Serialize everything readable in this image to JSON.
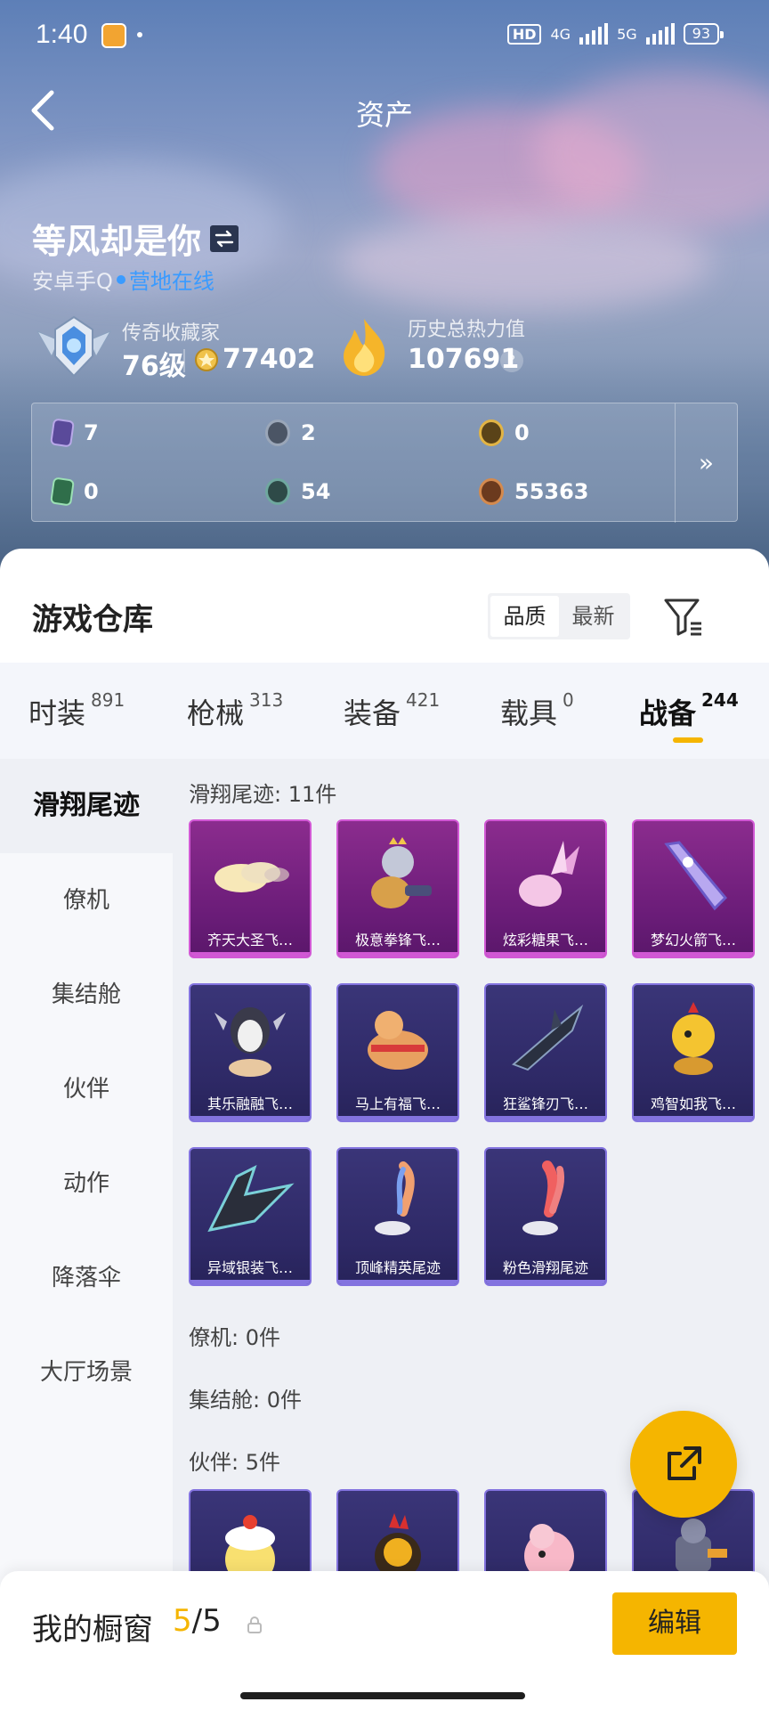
{
  "status_bar": {
    "time": "1:40",
    "network1": "4G",
    "network2": "5G",
    "battery": "93",
    "hd": "HD"
  },
  "header": {
    "title": "资产"
  },
  "profile": {
    "name": "等风却是你",
    "sub_prefix": "安卓手Q",
    "online_text": "营地在线",
    "collector_title": "传奇收藏家",
    "level": "76级",
    "coins": "77402",
    "heat_title": "历史总热力值",
    "heat_value": "107691",
    "help": "?"
  },
  "resources": [
    {
      "icon": "purple-card-icon",
      "value": "7"
    },
    {
      "icon": "silver-coin-icon",
      "value": "2"
    },
    {
      "icon": "gold-coin-icon",
      "value": "0"
    },
    {
      "icon": "green-card-icon",
      "value": "0"
    },
    {
      "icon": "jade-coin-icon",
      "value": "54"
    },
    {
      "icon": "bronze-coin-icon",
      "value": "55363"
    }
  ],
  "resources_more": "»",
  "warehouse": {
    "title": "游戏仓库",
    "sort_options": [
      "品质",
      "最新"
    ],
    "sort_active": "品质"
  },
  "categories": [
    {
      "label": "时装",
      "count": "891"
    },
    {
      "label": "枪械",
      "count": "313"
    },
    {
      "label": "装备",
      "count": "421"
    },
    {
      "label": "载具",
      "count": "0"
    },
    {
      "label": "战备",
      "count": "244",
      "active": true
    }
  ],
  "side_nav": [
    "滑翔尾迹",
    "僚机",
    "集结舱",
    "伙伴",
    "动作",
    "降落伞",
    "大厅场景"
  ],
  "sections": {
    "glide_trails": {
      "title": "滑翔尾迹: 11件",
      "items": [
        {
          "label": "齐天大圣飞…",
          "rarity": "purple"
        },
        {
          "label": "极意拳锋飞…",
          "rarity": "purple"
        },
        {
          "label": "炫彩糖果飞…",
          "rarity": "purple"
        },
        {
          "label": "梦幻火箭飞…",
          "rarity": "purple"
        },
        {
          "label": "其乐融融飞…",
          "rarity": "blue"
        },
        {
          "label": "马上有福飞…",
          "rarity": "blue"
        },
        {
          "label": "狂鲨锋刃飞…",
          "rarity": "blue"
        },
        {
          "label": "鸡智如我飞…",
          "rarity": "blue"
        },
        {
          "label": "异域银装飞…",
          "rarity": "blue"
        },
        {
          "label": "顶峰精英尾迹",
          "rarity": "blue"
        },
        {
          "label": "粉色滑翔尾迹",
          "rarity": "blue"
        }
      ]
    },
    "wingman": {
      "title": "僚机: 0件"
    },
    "pod": {
      "title": "集结舱: 0件"
    },
    "companion": {
      "title": "伙伴: 5件"
    }
  },
  "bottom": {
    "showcase_label": "我的橱窗",
    "showcase_current": "5",
    "showcase_total": "/5",
    "edit_label": "编辑"
  },
  "colors": {
    "accent": "#f5b500",
    "purple_rarity": "#d158d4",
    "blue_rarity": "#8373df",
    "online": "#3a9bff"
  }
}
